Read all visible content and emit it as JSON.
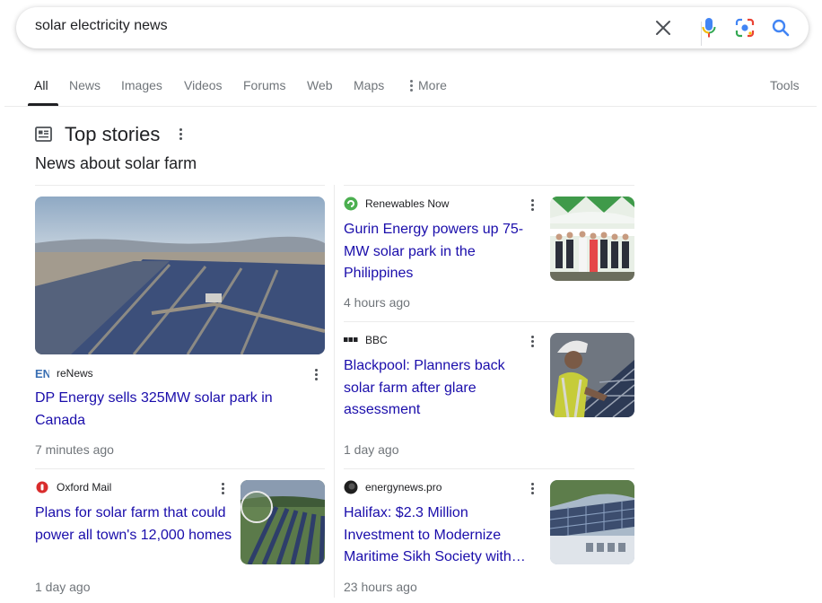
{
  "search": {
    "query": "solar electricity news",
    "clear_icon": "close-icon",
    "voice_icon": "mic-icon",
    "lens_icon": "camera-lens-icon",
    "search_icon": "search-icon"
  },
  "tabs": {
    "items": [
      {
        "label": "All",
        "active": true
      },
      {
        "label": "News"
      },
      {
        "label": "Images"
      },
      {
        "label": "Videos"
      },
      {
        "label": "Forums"
      },
      {
        "label": "Web"
      },
      {
        "label": "Maps"
      },
      {
        "label": "More"
      }
    ],
    "tools_label": "Tools"
  },
  "top_stories": {
    "title": "Top stories",
    "subtitle": "News about solar farm",
    "stories": [
      {
        "source": "reNews",
        "headline": "DP Energy sells 325MW solar park in Canada",
        "time": "7 minutes ago",
        "favicon": "renews-logo"
      },
      {
        "source": "Renewables Now",
        "headline": "Gurin Energy powers up 75-MW solar park in the Philippines",
        "time": "4 hours ago",
        "favicon": "renewables-now-logo"
      },
      {
        "source": "BBC",
        "headline": "Blackpool: Planners back solar farm after glare assessment",
        "time": "1 day ago",
        "favicon": "bbc-logo"
      },
      {
        "source": "Oxford Mail",
        "headline": "Plans for solar farm that could power all town's 12,000 homes",
        "time": "1 day ago",
        "favicon": "oxford-mail-logo"
      },
      {
        "source": "energynews.pro",
        "headline": "Halifax: $2.3 Million Investment to Modernize Maritime Sikh Society with…",
        "time": "23 hours ago",
        "favicon": "energynews-logo"
      }
    ]
  },
  "colors": {
    "link": "#1a0dab",
    "muted": "#70757a",
    "google_blue": "#4285f4",
    "google_red": "#ea4335",
    "google_yellow": "#fbbc05",
    "google_green": "#34a853"
  }
}
